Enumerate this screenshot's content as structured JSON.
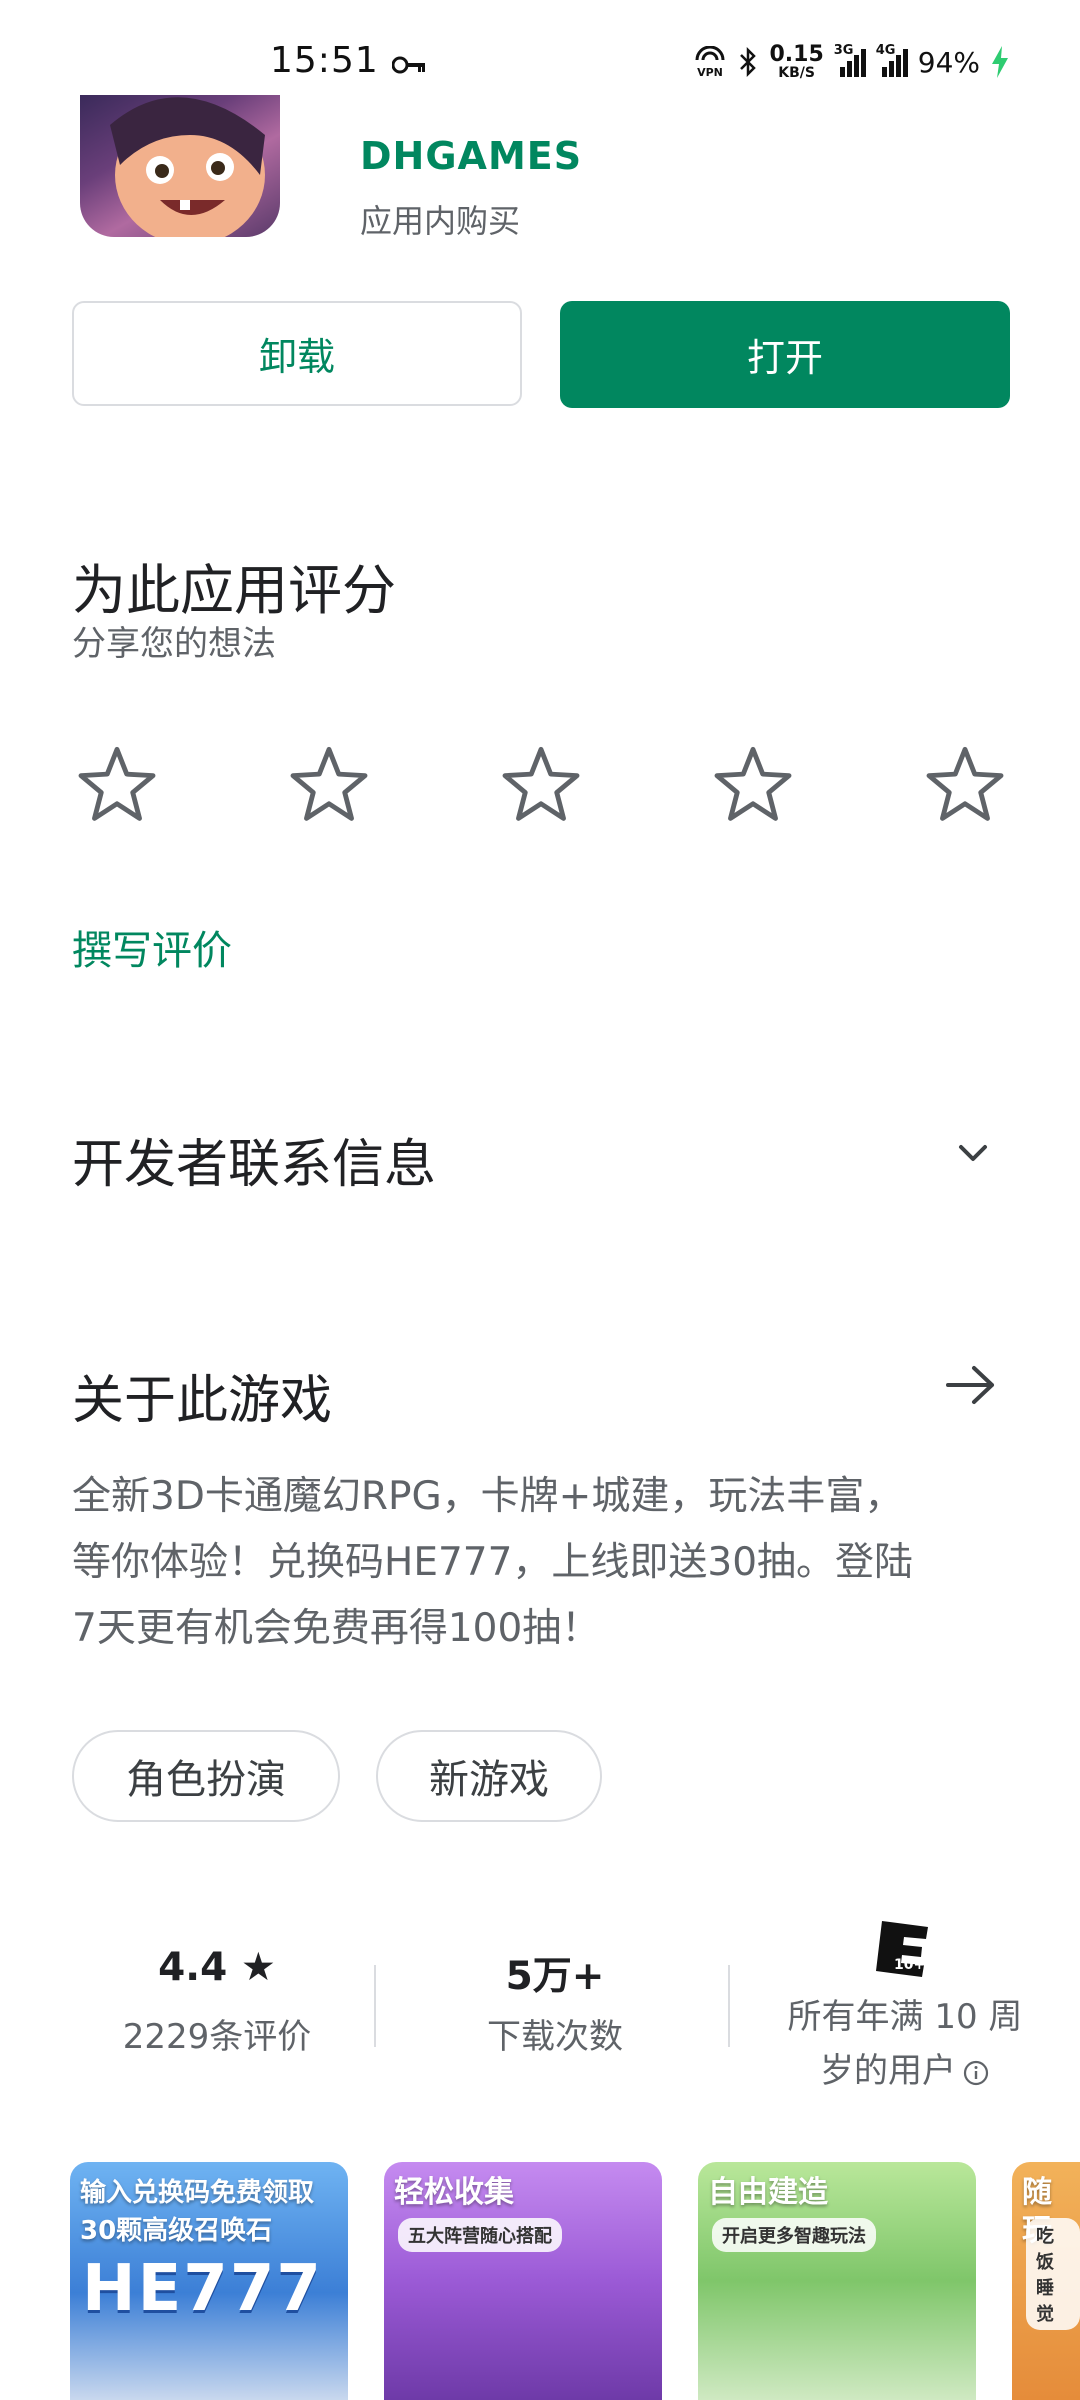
{
  "status_bar": {
    "time": "15:51",
    "speed_value": "0.15",
    "speed_unit": "KB/S",
    "net1": "3G",
    "net2": "4G",
    "battery": "94%"
  },
  "app": {
    "developer": "DHGAMES",
    "in_app_purchases": "应用内购买"
  },
  "buttons": {
    "uninstall": "卸载",
    "open": "打开"
  },
  "rate": {
    "title": "为此应用评分",
    "subtitle": "分享您的想法",
    "stars": 5,
    "write_review": "撰写评价"
  },
  "developer_contact": {
    "title": "开发者联系信息"
  },
  "about": {
    "title": "关于此游戏",
    "description_lines": [
      "全新3D卡通魔幻RPG，卡牌+城建，玩法丰富，",
      "等你体验！兑换码HE777，上线即送30抽。登陆",
      "7天更有机会免费再得100抽！"
    ],
    "tags": [
      "角色扮演",
      "新游戏"
    ]
  },
  "stats": {
    "rating_value": "4.4",
    "rating_star": "★",
    "reviews": "2229条评价",
    "downloads_value": "5万+",
    "downloads_label": "下载次数",
    "content_rating_line1": "所有年满 10 周",
    "content_rating_line2": "岁的用户"
  },
  "screenshots": [
    {
      "caption_line1": "输入兑换码免费领取",
      "caption_line2": "30颗高级召唤石",
      "code": "HE777"
    },
    {
      "caption": "轻松收集",
      "sub": "五大阵营随心搭配"
    },
    {
      "caption": "自由建造",
      "sub": "开启更多智趣玩法"
    },
    {
      "caption": "随玩",
      "sub": "吃饭睡觉"
    }
  ],
  "colors": {
    "accent": "#01875f",
    "secondary_text": "#5f6368",
    "border": "#dadce0"
  }
}
